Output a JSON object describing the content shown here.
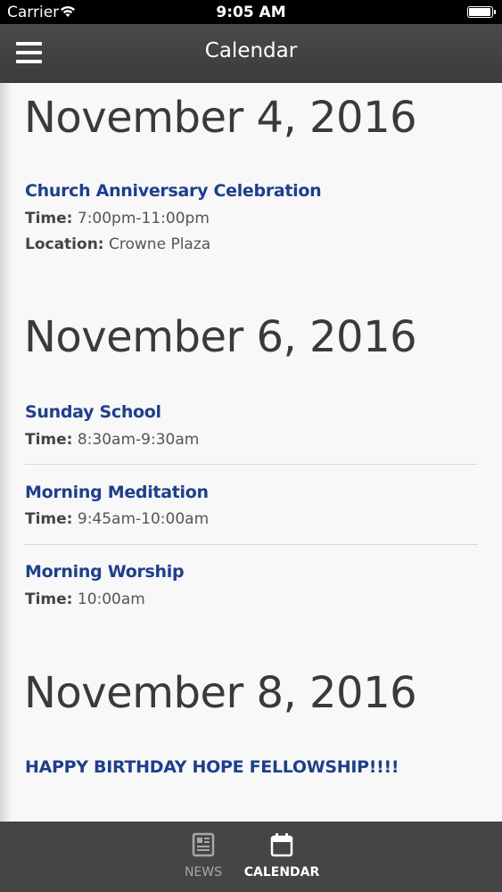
{
  "status_bar": {
    "carrier": "Carrier",
    "time": "9:05 AM",
    "wifi_icon": "wifi-icon",
    "battery_icon": "battery-icon"
  },
  "nav": {
    "title": "Calendar",
    "menu_icon": "hamburger-menu-icon"
  },
  "colors": {
    "event_title": "#1f3f8c",
    "nav_bg": "#404040",
    "tab_active": "#ffffff",
    "tab_inactive": "#a8a8a8"
  },
  "days": [
    {
      "date": "November 4, 2016",
      "events": [
        {
          "title": "Church Anniversary Celebration",
          "time_label": "Time:",
          "time": "7:00pm-11:00pm",
          "location_label": "Location:",
          "location": "Crowne Plaza"
        }
      ]
    },
    {
      "date": "November 6, 2016",
      "events": [
        {
          "title": "Sunday School",
          "time_label": "Time:",
          "time": "8:30am-9:30am"
        },
        {
          "title": "Morning Meditation",
          "time_label": "Time:",
          "time": "9:45am-10:00am"
        },
        {
          "title": "Morning Worship",
          "time_label": "Time:",
          "time": "10:00am"
        }
      ]
    },
    {
      "date": "November 8, 2016",
      "events": [
        {
          "title": "HAPPY BIRTHDAY HOPE FELLOWSHIP!!!!"
        }
      ]
    }
  ],
  "tabs": [
    {
      "label": "NEWS",
      "icon": "newspaper-icon",
      "active": false
    },
    {
      "label": "CALENDAR",
      "icon": "calendar-icon",
      "active": true
    }
  ]
}
